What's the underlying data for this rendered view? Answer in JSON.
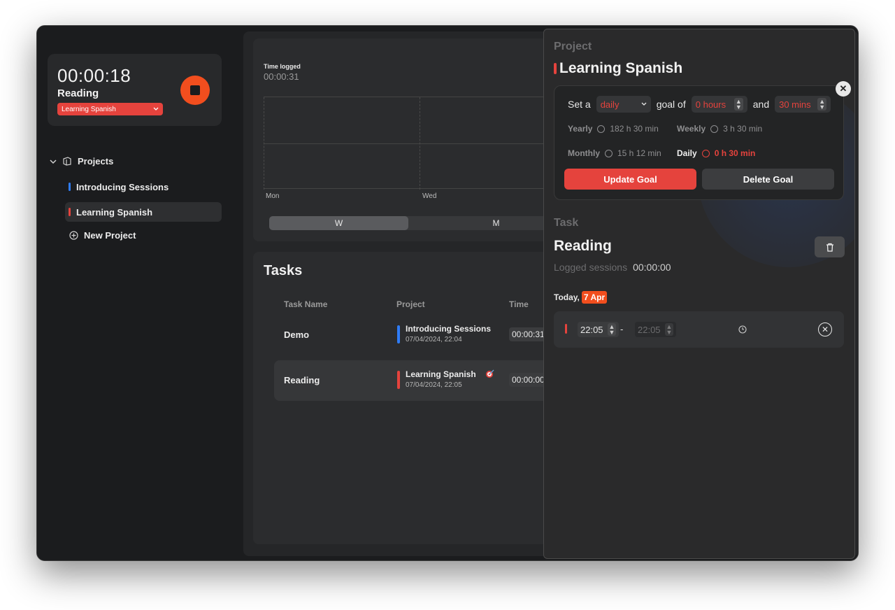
{
  "timer": {
    "elapsed": "00:00:18",
    "task": "Reading",
    "project": "Learning Spanish"
  },
  "sidebar": {
    "section_label": "Projects",
    "projects": [
      {
        "label": "Introducing Sessions",
        "color": "#2f7cf6"
      },
      {
        "label": "Learning Spanish",
        "color": "#e5433d"
      }
    ],
    "new_project_label": "New Project"
  },
  "chart": {
    "label": "Time logged",
    "value": "00:00:31",
    "days": [
      "Mon",
      "Wed"
    ],
    "segments": [
      "W",
      "M"
    ],
    "active_segment": "W"
  },
  "tasks": {
    "title": "Tasks",
    "columns": [
      "Task Name",
      "Project",
      "Time"
    ],
    "rows": [
      {
        "name": "Demo",
        "project": "Introducing Sessions",
        "date": "07/04/2024, 22:04",
        "time": "00:00:31",
        "color": "#2f7cf6"
      },
      {
        "name": "Reading",
        "project": "Learning Spanish",
        "date": "07/04/2024, 22:05",
        "time": "00:00:00",
        "color": "#e5433d",
        "icon": "goal-target-icon"
      }
    ]
  },
  "inspector": {
    "project_header": "Project",
    "project_name": "Learning Spanish",
    "goal": {
      "prefix": "Set a",
      "period": "daily",
      "middle": "goal of",
      "hours": "0 hours",
      "conj": "and",
      "mins": "30 mins",
      "stats": [
        {
          "label": "Yearly",
          "value": "182 h 30 min"
        },
        {
          "label": "Weekly",
          "value": "3 h 30 min"
        },
        {
          "label": "Monthly",
          "value": "15 h 12 min"
        },
        {
          "label": "Daily",
          "value": "0 h 30 min"
        }
      ],
      "update_label": "Update Goal",
      "delete_label": "Delete Goal"
    },
    "task_header": "Task",
    "task_name": "Reading",
    "logged_label": "Logged sessions",
    "logged_value": "00:00:00",
    "today_label": "Today,",
    "today_date": "7 Apr",
    "session": {
      "start": "22:05",
      "sep": "-",
      "end": "22:05"
    }
  },
  "colors": {
    "accent": "#f24e1e",
    "red": "#e5433d",
    "blue": "#2f7cf6"
  }
}
